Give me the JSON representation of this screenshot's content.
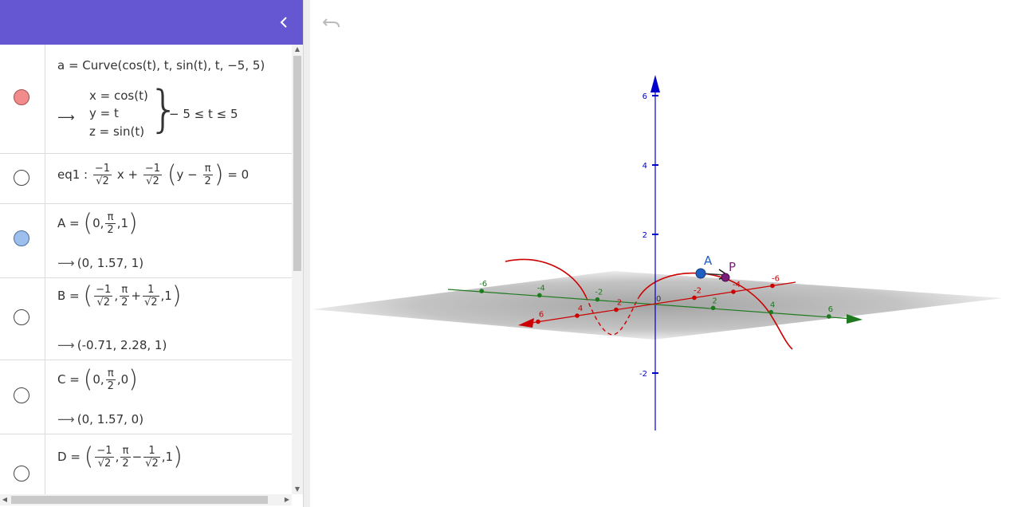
{
  "algebra": {
    "collapse_icon": "chevron-left-icon",
    "rows": [
      {
        "id": "a",
        "marble_color": "#f28c8c",
        "definition": "a = Curve(cos(t), t, sin(t), t, −5, 5)",
        "output_x": "x = cos(t)",
        "output_y": "y = t",
        "output_z": "z = sin(t)",
        "output_range": "− 5 ≤ t ≤ 5"
      },
      {
        "id": "eq1",
        "marble_color": "#ffffff",
        "label": "eq1 :",
        "frac1_num": "−1",
        "frac1_den": "√2",
        "x_term": "x +",
        "frac2_num": "−1",
        "frac2_den": "√2",
        "inner": "y −",
        "pi_num": "π",
        "pi_den": "2",
        "rhs": "= 0"
      },
      {
        "id": "A",
        "marble_color": "#9dbfee",
        "label": "A =",
        "c1": "0,",
        "pi_num": "π",
        "pi_den": "2",
        "c3": ",1",
        "output": "(0, 1.57, 1)"
      },
      {
        "id": "B",
        "marble_color": "#ffffff",
        "label": "B =",
        "f1_num": "−1",
        "f1_den": "√2",
        "pi_num": "π",
        "pi_den": "2",
        "plus": "+",
        "f2_num": "1",
        "f2_den": "√2",
        "c3": ",1",
        "output": "(-0.71, 2.28, 1)"
      },
      {
        "id": "C",
        "marble_color": "#ffffff",
        "label": "C =",
        "c1": "0,",
        "pi_num": "π",
        "pi_den": "2",
        "c3": ",0",
        "output": "(0, 1.57, 0)"
      },
      {
        "id": "D",
        "marble_color": "#ffffff",
        "label": "D =",
        "f1_num": "−1",
        "f1_den": "√2",
        "pi_num": "π",
        "pi_den": "2",
        "minus": "−",
        "f2_num": "1",
        "f2_den": "√2",
        "c3": ",1"
      }
    ]
  },
  "view3d": {
    "undo_icon": "undo-icon",
    "z_ticks": [
      "6",
      "4",
      "2",
      "-2"
    ],
    "y_ticks": [
      "-6",
      "-4",
      "-2",
      "2",
      "4",
      "6"
    ],
    "x_ticks": [
      "-6",
      "-4",
      "-2",
      "2",
      "4",
      "6"
    ],
    "origin_label": "0",
    "point_A_label": "A",
    "point_P_label": "P",
    "colors": {
      "header": "#6557d2",
      "x_axis": "#cc0000",
      "y_axis": "#1f7a1f",
      "z_axis": "#0000cc",
      "curve": "#cc0000",
      "point_A": "#1f5fbf",
      "point_P": "#7a1f7a"
    }
  }
}
